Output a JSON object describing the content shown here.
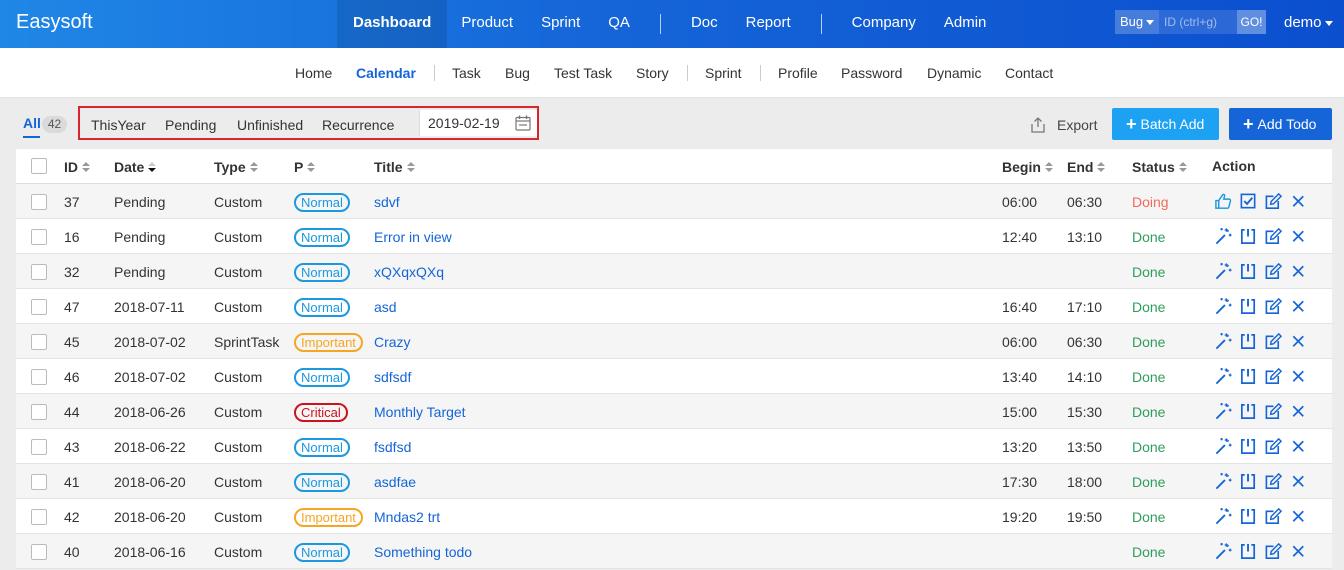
{
  "brand": "Easysoft",
  "main_nav": [
    {
      "label": "Dashboard",
      "active": true
    },
    {
      "label": "Product"
    },
    {
      "label": "Sprint"
    },
    {
      "label": "QA"
    },
    {
      "label": "Doc"
    },
    {
      "label": "Report"
    },
    {
      "label": "Company"
    },
    {
      "label": "Admin"
    }
  ],
  "search": {
    "type": "Bug",
    "placeholder": "ID (ctrl+g)",
    "go_label": "GO!"
  },
  "user": "demo",
  "sub_nav": [
    "Home",
    "Calendar",
    "Task",
    "Bug",
    "Test Task",
    "Story",
    "Sprint",
    "Profile",
    "Password",
    "Dynamic",
    "Contact"
  ],
  "sub_nav_active": "Calendar",
  "toolbar": {
    "all_label": "All",
    "all_count": "42",
    "filters": [
      "ThisYear",
      "Pending",
      "Unfinished",
      "Recurrence"
    ],
    "date": "2019-02-19",
    "export_label": "Export",
    "batch_add_label": "Batch Add",
    "add_todo_label": "Add Todo"
  },
  "table": {
    "headers": {
      "id": "ID",
      "date": "Date",
      "type": "Type",
      "pri": "P",
      "title": "Title",
      "begin": "Begin",
      "end": "End",
      "status": "Status",
      "action": "Action"
    },
    "rows": [
      {
        "id": "37",
        "date": "Pending",
        "type": "Custom",
        "pri": "Normal",
        "title": "sdvf",
        "begin": "06:00",
        "end": "06:30",
        "status": "Doing"
      },
      {
        "id": "16",
        "date": "Pending",
        "type": "Custom",
        "pri": "Normal",
        "title": "Error in view",
        "begin": "12:40",
        "end": "13:10",
        "status": "Done"
      },
      {
        "id": "32",
        "date": "Pending",
        "type": "Custom",
        "pri": "Normal",
        "title": "xQXqxQXq",
        "begin": "",
        "end": "",
        "status": "Done"
      },
      {
        "id": "47",
        "date": "2018-07-11",
        "type": "Custom",
        "pri": "Normal",
        "title": "asd",
        "begin": "16:40",
        "end": "17:10",
        "status": "Done"
      },
      {
        "id": "45",
        "date": "2018-07-02",
        "type": "SprintTask",
        "pri": "Important",
        "title": "Crazy",
        "begin": "06:00",
        "end": "06:30",
        "status": "Done"
      },
      {
        "id": "46",
        "date": "2018-07-02",
        "type": "Custom",
        "pri": "Normal",
        "title": "sdfsdf",
        "begin": "13:40",
        "end": "14:10",
        "status": "Done"
      },
      {
        "id": "44",
        "date": "2018-06-26",
        "type": "Custom",
        "pri": "Critical",
        "title": "Monthly Target",
        "begin": "15:00",
        "end": "15:30",
        "status": "Done"
      },
      {
        "id": "43",
        "date": "2018-06-22",
        "type": "Custom",
        "pri": "Normal",
        "title": "fsdfsd",
        "begin": "13:20",
        "end": "13:50",
        "status": "Done"
      },
      {
        "id": "41",
        "date": "2018-06-20",
        "type": "Custom",
        "pri": "Normal",
        "title": "asdfae",
        "begin": "17:30",
        "end": "18:00",
        "status": "Done"
      },
      {
        "id": "42",
        "date": "2018-06-20",
        "type": "Custom",
        "pri": "Important",
        "title": "Mndas2 trt",
        "begin": "19:20",
        "end": "19:50",
        "status": "Done"
      },
      {
        "id": "40",
        "date": "2018-06-16",
        "type": "Custom",
        "pri": "Normal",
        "title": "Something todo",
        "begin": "",
        "end": "",
        "status": "Done"
      }
    ]
  },
  "colors": {
    "brand_blue": "#1565d8",
    "batch_add": "#1da1f2",
    "doing": "#f26a5c",
    "done": "#2e9d5c",
    "pri_normal": "#1b98e0",
    "pri_important": "#f5a623",
    "pri_critical": "#c9141d",
    "highlight_box": "#d9262c"
  },
  "icons": {
    "first_row_actions": [
      "thumbs-up-icon",
      "check-square-icon",
      "edit-icon",
      "close-icon"
    ],
    "other_row_actions": [
      "magic-wand-icon",
      "finish-icon",
      "edit-icon",
      "close-icon"
    ]
  }
}
